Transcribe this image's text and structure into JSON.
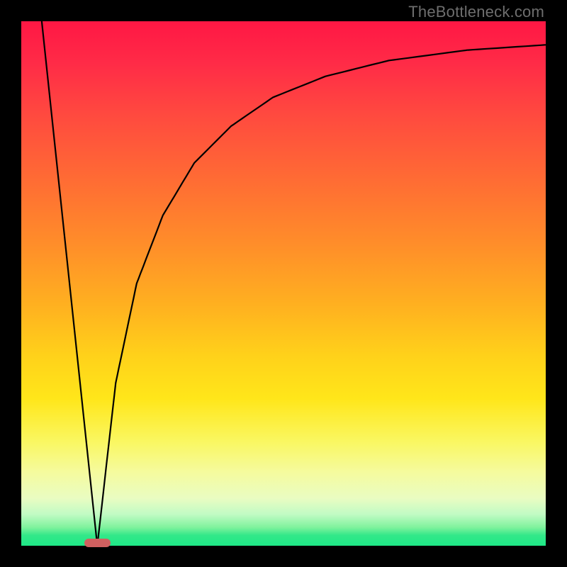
{
  "watermark": "TheBottleneck.com",
  "colors": {
    "frame": "#000000",
    "watermark": "#6e6e6e",
    "marker_fill": "#d06060",
    "curve_stroke": "#000000"
  },
  "chart_data": {
    "type": "line",
    "title": "",
    "xlabel": "",
    "ylabel": "",
    "xlim": [
      0,
      1
    ],
    "ylim": [
      0,
      1
    ],
    "gradient_background": true,
    "notch_x": 0.145,
    "marker": {
      "x": 0.145,
      "y": 0.995,
      "width_frac": 0.05,
      "height_frac": 0.016
    },
    "series": [
      {
        "name": "left-branch",
        "x": [
          0.039,
          0.145
        ],
        "y": [
          1.0,
          0.0
        ]
      },
      {
        "name": "right-branch",
        "x": [
          0.145,
          0.18,
          0.22,
          0.27,
          0.33,
          0.4,
          0.48,
          0.58,
          0.7,
          0.85,
          1.0
        ],
        "y": [
          0.0,
          0.31,
          0.5,
          0.63,
          0.73,
          0.8,
          0.855,
          0.895,
          0.925,
          0.945,
          0.955
        ]
      }
    ]
  }
}
